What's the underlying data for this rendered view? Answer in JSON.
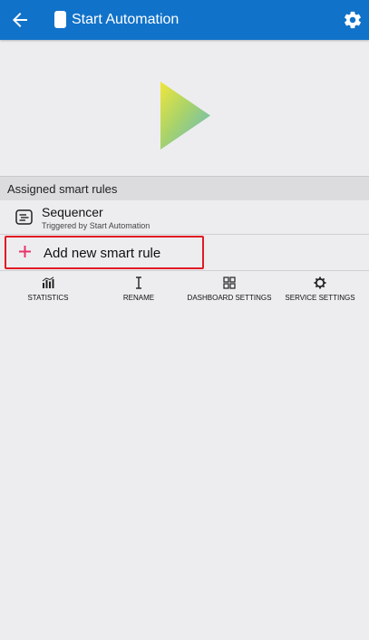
{
  "appbar": {
    "title": "Start Automation",
    "back_icon": "arrow-left-icon",
    "device_icon": "device-icon",
    "settings_icon": "gear-icon",
    "color": "#1172c9"
  },
  "hero": {
    "icon": "play-triangle-icon",
    "gradient": [
      "#f0e63c",
      "#5fb8c9"
    ]
  },
  "assigned": {
    "header": "Assigned smart rules",
    "rules": [
      {
        "name": "Sequencer",
        "subtitle": "Triggered by Start Automation",
        "icon": "sequencer-icon"
      }
    ],
    "add_label": "Add new smart rule",
    "add_icon": "plus-icon",
    "add_color": "#e8356b"
  },
  "actions": [
    {
      "label": "STATISTICS",
      "icon": "bar-chart-icon"
    },
    {
      "label": "RENAME",
      "icon": "text-cursor-icon"
    },
    {
      "label": "DASHBOARD SETTINGS",
      "icon": "grid-icon"
    },
    {
      "label": "SERVICE SETTINGS",
      "icon": "cog-icon"
    }
  ]
}
